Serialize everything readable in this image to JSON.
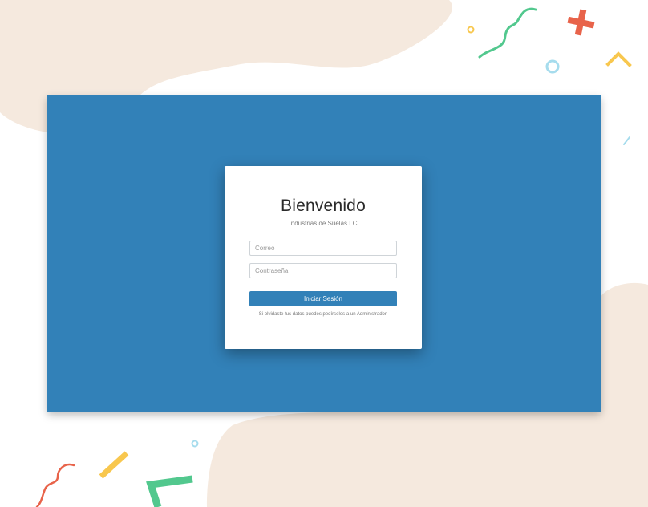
{
  "login": {
    "title": "Bienvenido",
    "subtitle": "Industrias de Suelas LC",
    "email_placeholder": "Correo",
    "email_value": "",
    "password_placeholder": "Contraseña",
    "password_value": "",
    "submit_label": "Iniciar Sesión",
    "help_text": "Si olvidaste tus datos puedes pedírselos a un Administrador."
  },
  "colors": {
    "primary": "#3281b8",
    "background_blob": "#f5e9de",
    "confetti_green": "#52c88e",
    "confetti_red": "#e8634a",
    "confetti_yellow": "#f8c74e",
    "confetti_cyan": "#a6dced"
  }
}
